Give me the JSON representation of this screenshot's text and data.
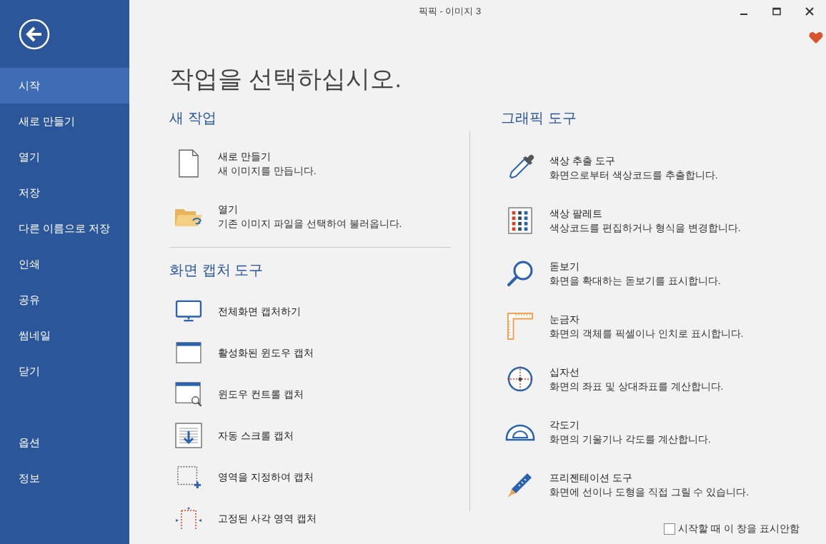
{
  "window": {
    "title": "픽픽 - 이미지 3"
  },
  "sidebar": {
    "items": [
      {
        "label": "시작",
        "selected": true
      },
      {
        "label": "새로 만들기",
        "selected": false
      },
      {
        "label": "열기",
        "selected": false
      },
      {
        "label": "저장",
        "selected": false
      },
      {
        "label": "다른 이름으로 저장",
        "selected": false
      },
      {
        "label": "인쇄",
        "selected": false
      },
      {
        "label": "공유",
        "selected": false
      },
      {
        "label": "썸네일",
        "selected": false
      },
      {
        "label": "닫기",
        "selected": false
      }
    ],
    "bottom_items": [
      {
        "label": "옵션",
        "selected": false
      },
      {
        "label": "정보",
        "selected": false
      }
    ]
  },
  "heading": "작업을 선택하십시오.",
  "new_task": {
    "heading": "새 작업",
    "items": [
      {
        "kind": "new",
        "title": "새로 만들기",
        "description": "새 이미지를 만듭니다."
      },
      {
        "kind": "open",
        "title": "열기",
        "description": "기존 이미지 파일을 선택하여 불러옵니다."
      }
    ]
  },
  "capture": {
    "heading": "화면 캡처 도구",
    "items": [
      {
        "kind": "fullscreen",
        "title": "전체화면 캡처하기"
      },
      {
        "kind": "window",
        "title": "활성화된 윈도우 캡처"
      },
      {
        "kind": "control",
        "title": "윈도우 컨트롤 캡처"
      },
      {
        "kind": "scroll",
        "title": "자동 스크롤 캡처"
      },
      {
        "kind": "region",
        "title": "영역을 지정하여 캡처"
      },
      {
        "kind": "fixed",
        "title": "고정된 사각 영역 캡처"
      }
    ]
  },
  "graphics": {
    "heading": "그래픽 도구",
    "items": [
      {
        "kind": "picker",
        "title": "색상 추출 도구",
        "description": "화면으로부터 색상코드를 추출합니다."
      },
      {
        "kind": "palette",
        "title": "색상 팔레트",
        "description": "색상코드를 편집하거나 형식을 변경합니다."
      },
      {
        "kind": "magnifier",
        "title": "돋보기",
        "description": "화면을 확대하는 돋보기를 표시합니다."
      },
      {
        "kind": "ruler",
        "title": "눈금자",
        "description": "화면의 객체를 픽셀이나 인치로 표시합니다."
      },
      {
        "kind": "crosshair",
        "title": "십자선",
        "description": "화면의 좌표 및 상대좌표를 계산합니다."
      },
      {
        "kind": "protractor",
        "title": "각도기",
        "description": "화면의 기울기나 각도를 계산합니다."
      },
      {
        "kind": "pen",
        "title": "프리젠테이션 도구",
        "description": "화면에 선이나 도형을 직접 그릴 수 있습니다."
      }
    ]
  },
  "startup_checkbox": {
    "label": "시작할 때 이 창을 표시안함",
    "checked": false
  }
}
